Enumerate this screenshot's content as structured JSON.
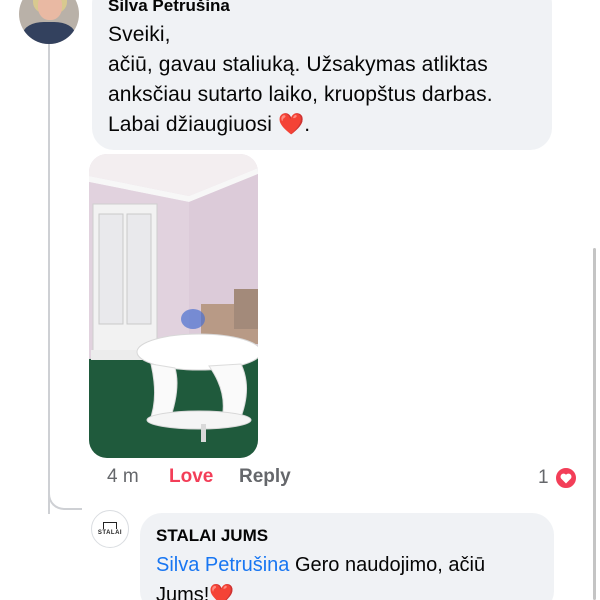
{
  "comment": {
    "author": "Silva Petrušina",
    "lines": [
      "Sveiki,",
      "ačiū, gavau staliuką. Užsakymas atliktas",
      "anksčiau sutarto laiko, kruopštus darbas.",
      "Labai džiaugiuosi"
    ],
    "emoji": "❤️",
    "suffix": ".",
    "time": "4 m",
    "love_label": "Love",
    "reply_label": "Reply",
    "reaction_count": "1"
  },
  "reply": {
    "author": "STALAI JUMS",
    "logo_text": "STALAI",
    "mention": "Silva Petrušina",
    "text": " Gero naudojimo, ačiū Jums!",
    "emoji": "❤️"
  },
  "colors": {
    "bubble": "#f0f2f5",
    "love": "#f33e58",
    "mention": "#1876f2",
    "meta": "#65676b"
  },
  "icons": {
    "reaction": "heart-icon",
    "page_logo": "stalai-logo-icon"
  }
}
